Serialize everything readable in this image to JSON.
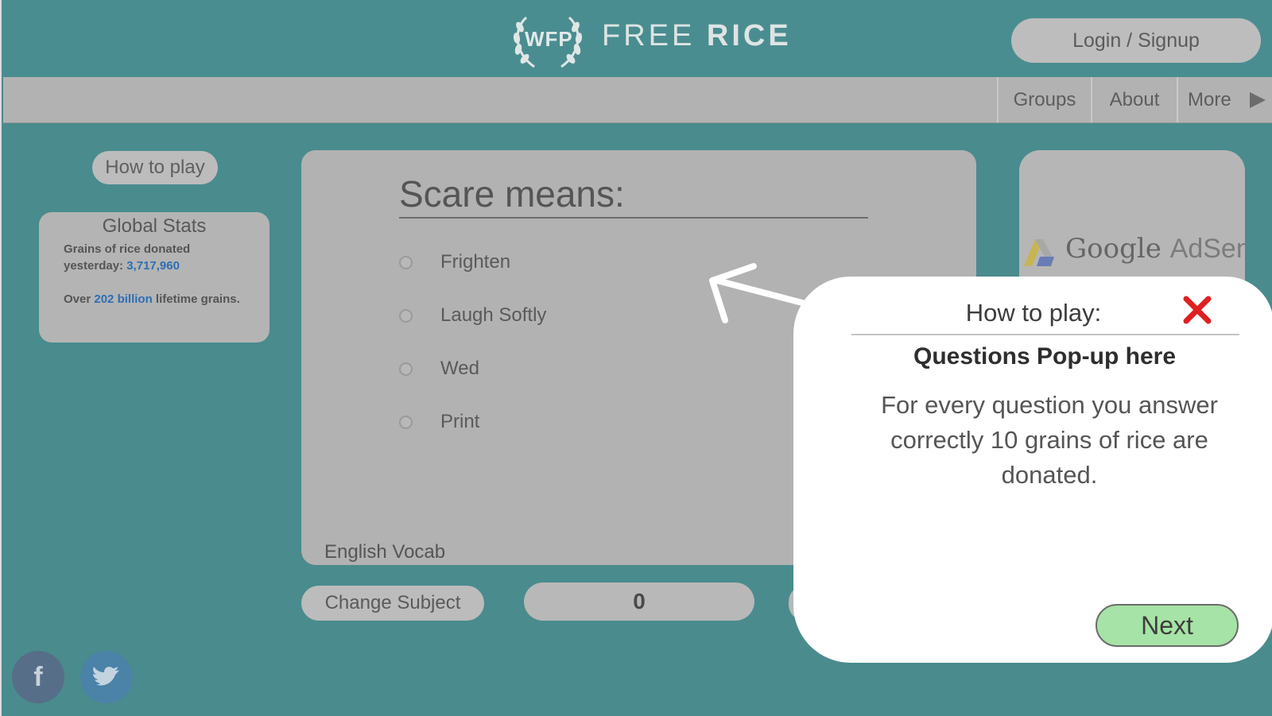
{
  "header": {
    "logo_text": "WFP",
    "brand_left": "FREE",
    "brand_right": "RICE",
    "login_label": "Login / Signup"
  },
  "nav": {
    "items": [
      {
        "label": "Groups"
      },
      {
        "label": "About"
      },
      {
        "label": "More"
      }
    ]
  },
  "sidebar": {
    "how_to_play_label": "How to play",
    "stats": {
      "title": "Global Stats",
      "yesterday_prefix": "Grains of rice donated yesterday:",
      "yesterday_value": "3,717,960",
      "lifetime_prefix": "Over",
      "lifetime_value": "202 billion",
      "lifetime_suffix": "lifetime grains."
    }
  },
  "quiz": {
    "question": "Scare means:",
    "options": [
      {
        "label": "Frighten"
      },
      {
        "label": "Laugh Softly"
      },
      {
        "label": "Wed"
      },
      {
        "label": "Print"
      }
    ],
    "subject": "English Vocab",
    "change_subject_label": "Change Subject",
    "score": "0"
  },
  "ad": {
    "text_brand": "Google",
    "text_product": "AdSense"
  },
  "social": {
    "facebook_glyph": "f"
  },
  "popup": {
    "title": "How to play:",
    "heading": "Questions Pop-up here",
    "body": "For every question you answer correctly 10 grains of rice are donated.",
    "next_label": "Next"
  },
  "colors": {
    "background": "#4a8b8d",
    "panel": "#b2b2b2",
    "next_button": "#a6e3a6",
    "close_icon": "#e02020",
    "highlight": "#2b6fb5"
  }
}
